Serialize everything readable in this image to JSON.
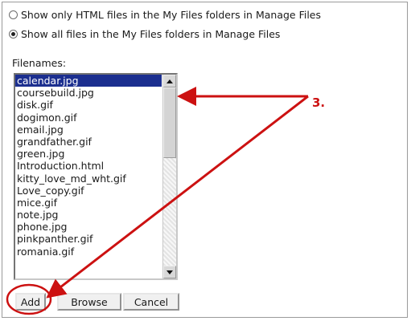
{
  "options": {
    "html_only_label": "Show only HTML files in the My Files folders in Manage Files",
    "all_files_label": "Show all files in the My Files folders in Manage Files",
    "selected": "all_files"
  },
  "filenames": {
    "label": "Filenames:",
    "items": [
      "calendar.jpg",
      "coursebuild.jpg",
      "disk.gif",
      "dogimon.gif",
      "email.jpg",
      "grandfather.gif",
      "green.jpg",
      "Introduction.html",
      "kitty_love_md_wht.gif",
      "Love_copy.gif",
      "mice.gif",
      "note.jpg",
      "phone.jpg",
      "pinkpanther.gif",
      "romania.gif"
    ],
    "selected_index": 0
  },
  "buttons": {
    "add": "Add",
    "browse": "Browse",
    "cancel": "Cancel"
  },
  "annotation": {
    "step_number": "3.",
    "color": "#cc1111"
  },
  "colors": {
    "selection_bg": "#1c2f8f",
    "selection_text": "#ffffff"
  }
}
